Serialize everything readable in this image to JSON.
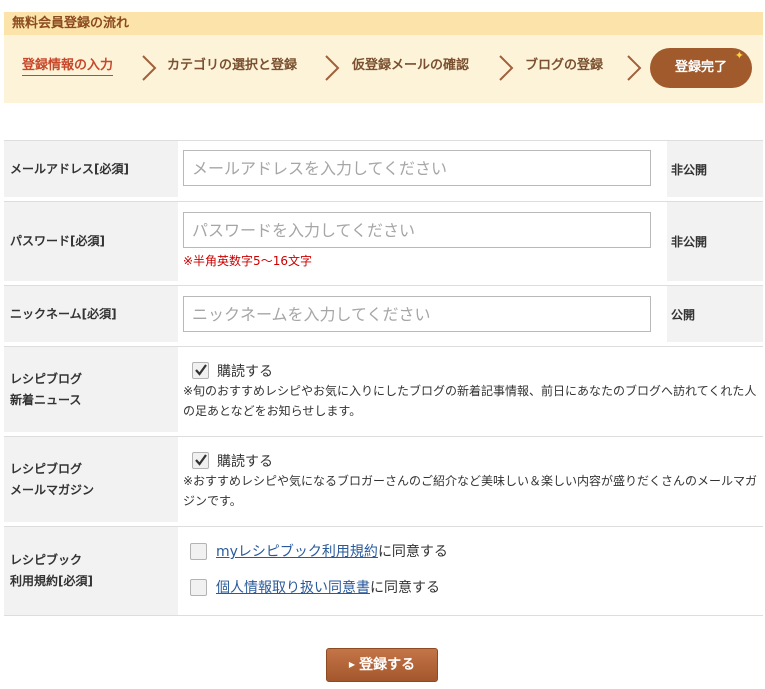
{
  "flow": {
    "title": "無料会員登録の流れ",
    "steps": [
      "登録情報の入力",
      "カテゴリの選択と登録",
      "仮登録メールの確認",
      "ブログの登録"
    ],
    "done": "登録完了"
  },
  "form": {
    "email": {
      "label": "メールアドレス[必須]",
      "placeholder": "メールアドレスを入力してください",
      "visibility": "非公開"
    },
    "password": {
      "label": "パスワード[必須]",
      "placeholder": "パスワードを入力してください",
      "hint": "※半角英数字5〜16文字",
      "visibility": "非公開"
    },
    "nickname": {
      "label": "ニックネーム[必須]",
      "placeholder": "ニックネームを入力してください",
      "visibility": "公開"
    },
    "news": {
      "label_1": "レシピブログ",
      "label_2": "新着ニュース",
      "checkbox_label": "購読する",
      "checked": true,
      "note": "※旬のおすすめレシピやお気に入りにしたブログの新着記事情報、前日にあなたのブログへ訪れてくれた人の足あとなどをお知らせします。"
    },
    "magazine": {
      "label_1": "レシピブログ",
      "label_2": "メールマガジン",
      "checkbox_label": "購読する",
      "checked": true,
      "note": "※おすすめレシピや気になるブロガーさんのご紹介など美味しい＆楽しい内容が盛りだくさんのメールマガジンです。"
    },
    "terms": {
      "label_1": "レシピブック",
      "label_2": "利用規約[必須]",
      "terms_link": "myレシピブック利用規約",
      "terms_suffix": "に同意する",
      "privacy_link": "個人情報取り扱い同意書",
      "privacy_suffix": "に同意する"
    }
  },
  "submit_label": "登録する"
}
